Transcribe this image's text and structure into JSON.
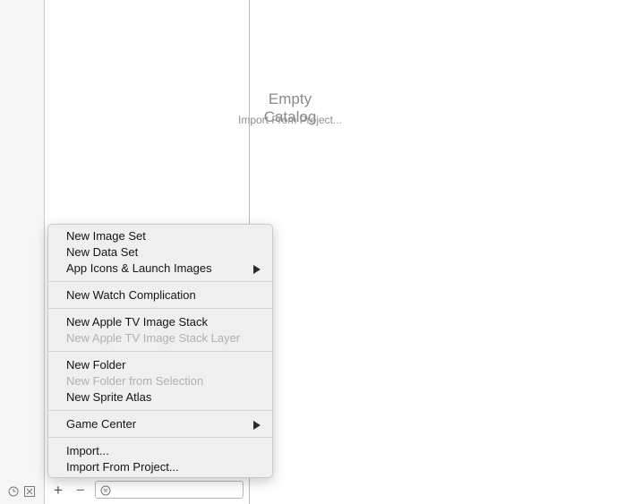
{
  "detail": {
    "empty_title": "Empty Catalog",
    "empty_link": "Import From Project..."
  },
  "bottom_bar": {
    "plus_label": "+",
    "minus_label": "−",
    "filter_value": "",
    "icons": [
      "clock-icon",
      "box-icon",
      "filter-icon"
    ]
  },
  "menu": {
    "new_image_set": "New Image Set",
    "new_data_set": "New Data Set",
    "app_icons": "App Icons & Launch Images",
    "new_watch_complication": "New Watch Complication",
    "new_tv_image_stack": "New Apple TV Image Stack",
    "new_tv_image_stack_layer": "New Apple TV Image Stack Layer",
    "new_folder": "New Folder",
    "new_folder_from_selection": "New Folder from Selection",
    "new_sprite_atlas": "New Sprite Atlas",
    "game_center": "Game Center",
    "import": "Import...",
    "import_from_project": "Import From Project..."
  },
  "colors": {
    "menu_bg": "#efefef",
    "disabled_text": "#b0b0b0",
    "placeholder_text": "#8a8a8a"
  }
}
